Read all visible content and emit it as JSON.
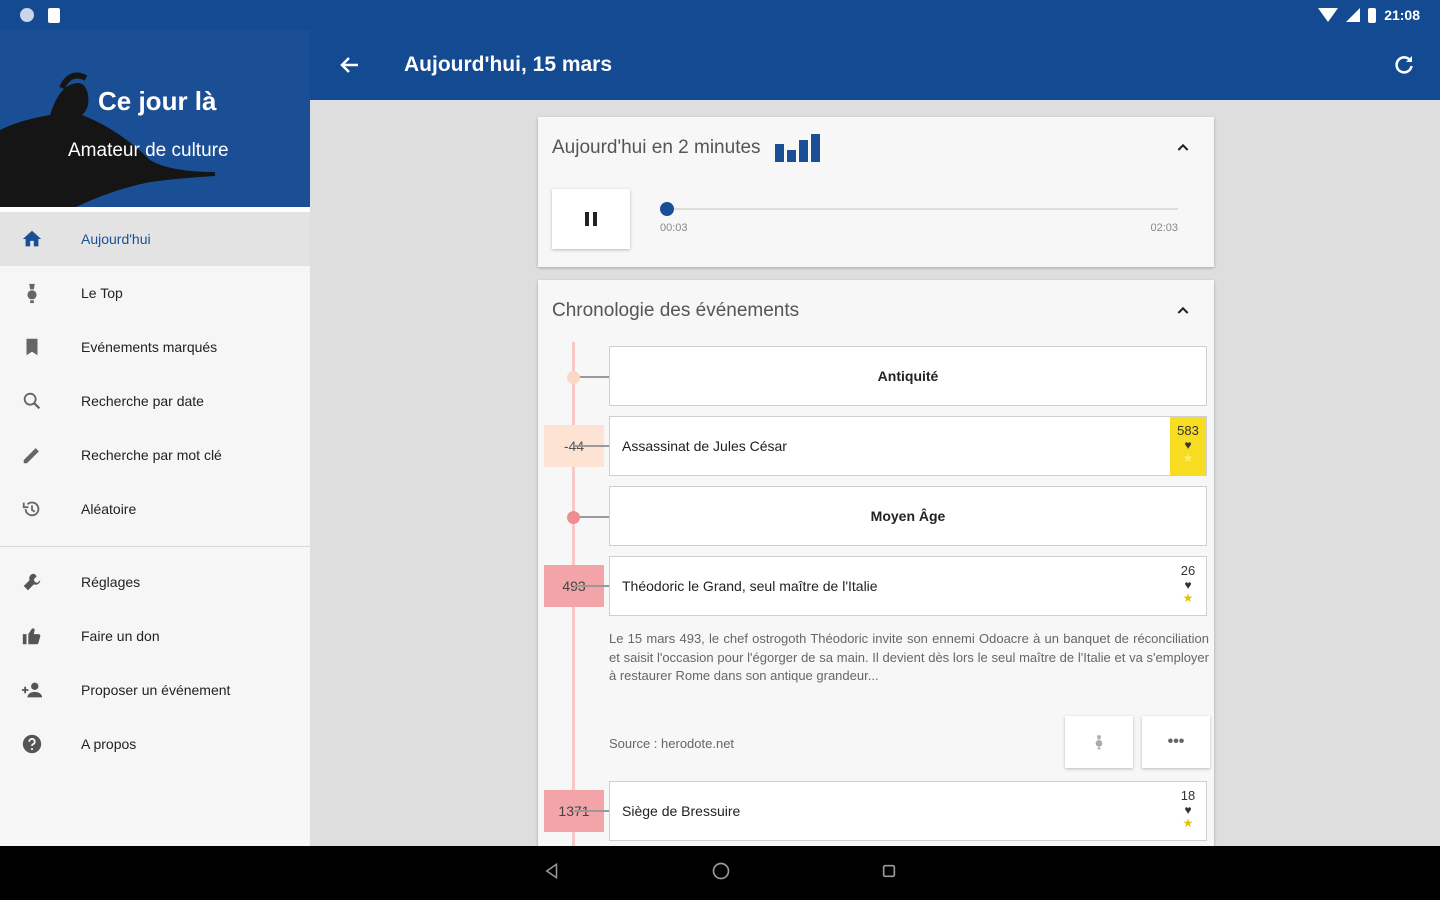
{
  "status_bar": {
    "time": "21:08"
  },
  "drawer": {
    "title": "Ce jour là",
    "subtitle": "Amateur de culture",
    "items": [
      {
        "label": "Aujourd'hui",
        "icon": "home-icon",
        "active": true
      },
      {
        "label": "Le Top",
        "icon": "medal-icon"
      },
      {
        "label": "Evénements marqués",
        "icon": "bookmark-icon"
      },
      {
        "label": "Recherche par date",
        "icon": "search-icon"
      },
      {
        "label": "Recherche par mot clé",
        "icon": "pencil-icon"
      },
      {
        "label": "Aléatoire",
        "icon": "history-icon"
      }
    ],
    "items2": [
      {
        "label": "Réglages",
        "icon": "wrench-icon"
      },
      {
        "label": "Faire un don",
        "icon": "thumbs-up-icon"
      },
      {
        "label": "Proposer un événement",
        "icon": "add-person-icon"
      },
      {
        "label": "A propos",
        "icon": "help-icon"
      }
    ]
  },
  "appbar": {
    "title": "Aujourd'hui, 15 mars"
  },
  "audio_card": {
    "title": "Aujourd'hui en 2 minutes",
    "progress": 0,
    "time_start": "00:03",
    "time_end": "02:03"
  },
  "timeline_card": {
    "title": "Chronologie des événements",
    "periods": [
      {
        "label": "Antiquité"
      },
      {
        "label": "Moyen Âge"
      }
    ],
    "events": [
      {
        "year": "-44",
        "title": "Assassinat de Jules César",
        "score": "583"
      },
      {
        "year": "493",
        "title": "Théodoric le Grand, seul maître de l'Italie",
        "score": "26",
        "description": "Le 15 mars 493, le chef ostrogoth Théodoric invite son ennemi Odoacre à un banquet de réconciliation et saisit l'occasion pour l'égorger de sa main. Il devient dès lors le seul maître de l'Italie et va s'employer à restaurer Rome dans son antique grandeur...",
        "source": "Source : herodote.net"
      },
      {
        "year": "1371",
        "title": "Siège de Bressuire",
        "score": "18"
      }
    ],
    "more_label": "•••"
  },
  "colors": {
    "primary": "#134a91",
    "accent_yellow": "#f7dc22",
    "antiquity_year_bg": "#fde3d3",
    "middle_ages_year_bg": "#f2a4a8"
  }
}
